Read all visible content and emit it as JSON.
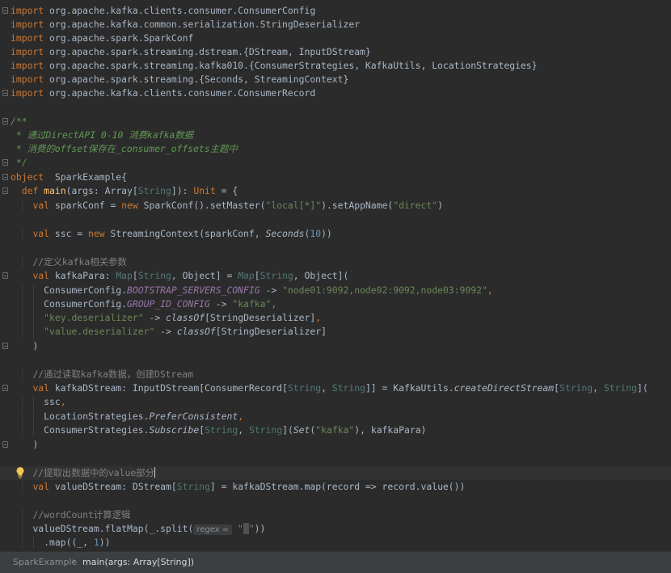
{
  "code": [
    [
      "import",
      " org.apache.kafka.clients.consumer.ConsumerConfig"
    ],
    [
      "import",
      " org.apache.kafka.common.serialization.StringDeserializer"
    ],
    [
      "import",
      " org.apache.spark.SparkConf"
    ],
    [
      "import",
      " org.apache.spark.streaming.dstream.{DStream, InputDStream}"
    ],
    [
      "import",
      " org.apache.spark.streaming.kafka010.{ConsumerStrategies, KafkaUtils, LocationStrategies}"
    ],
    [
      "import",
      " org.apache.spark.streaming.{Seconds, StreamingContext}"
    ],
    [
      "import",
      " org.apache.kafka.clients.consumer.ConsumerRecord"
    ],
    [],
    [
      "/**"
    ],
    [
      " * 通过DirectAPI 0-10 消费kafka数据"
    ],
    [
      " * 消费的offset保存在_consumer_offsets主题中"
    ],
    [
      " */"
    ],
    [
      "object",
      "  SparkExample{"
    ],
    [
      "  ",
      "def",
      " ",
      "main",
      "(args: Array[",
      "String",
      "]): ",
      "Unit",
      " = {"
    ],
    [
      "    ",
      "val",
      " sparkConf = ",
      "new",
      " SparkConf().setMaster(",
      "\"local[*]\"",
      ").setAppName(",
      "\"direct\"",
      ")"
    ],
    [],
    [
      "    ",
      "val",
      " ssc = ",
      "new",
      " StreamingContext(sparkConf, ",
      "Seconds",
      "(",
      "10",
      "))"
    ],
    [],
    [
      "    ",
      "//定义kafka相关参数"
    ],
    [
      "    ",
      "val",
      " kafkaPara: ",
      "Map",
      "[",
      "String",
      ", Object] = ",
      "Map",
      "[",
      "String",
      ", Object]("
    ],
    [
      "      ",
      "ConsumerConfig.",
      "BOOTSTRAP_SERVERS_CONFIG",
      " -> ",
      "\"node01:9092,node02:9092,node03:9092\"",
      ","
    ],
    [
      "      ",
      "ConsumerConfig.",
      "GROUP_ID_CONFIG",
      " -> ",
      "\"kafka\"",
      ","
    ],
    [
      "      ",
      "\"key.deserializer\"",
      " -> ",
      "classOf",
      "[StringDeserializer]",
      ","
    ],
    [
      "      ",
      "\"value.deserializer\"",
      " -> ",
      "classOf",
      "[StringDeserializer]"
    ],
    [
      "    ",
      ")"
    ],
    [],
    [
      "    ",
      "//通过读取kafka数据，创建DStream"
    ],
    [
      "    ",
      "val",
      " kafkaDStream: InputDStream[ConsumerRecord[",
      "String",
      ", ",
      "String",
      "]] = KafkaUtils.",
      "createDirectStream",
      "[",
      "String",
      ", ",
      "String",
      "]("
    ],
    [
      "      ",
      "ssc",
      ","
    ],
    [
      "      ",
      "LocationStrategies.",
      "PreferConsistent",
      ","
    ],
    [
      "      ",
      "ConsumerStrategies.",
      "Subscribe",
      "[",
      "String",
      ", ",
      "String",
      "](",
      "Set",
      "(",
      "\"kafka\"",
      "), kafkaPara)"
    ],
    [
      "    ",
      ")"
    ],
    [],
    [
      "    ",
      "//提取出数据中的value部分"
    ],
    [
      "    ",
      "val",
      " valueDStream: DStream[",
      "String",
      "] = kafkaDStream.map(record => record.value())"
    ],
    [],
    [
      "    ",
      "//wordCount计算逻辑"
    ],
    [
      "    ",
      "valueDStream.flatMap(_.split(",
      "regex =",
      " ",
      "\"",
      " ",
      "\"",
      "))"
    ],
    [
      "      ",
      ".map((_, ",
      "1",
      "))"
    ]
  ],
  "breadcrumb": {
    "object": "SparkExample",
    "separator": "›",
    "method": "main(args: Array[String])"
  },
  "icons": {
    "intention": "lightbulb-icon",
    "fold": "fold-marker-icon"
  },
  "colors": {
    "background": "#2b2b2b",
    "keyword": "#cc7832",
    "string": "#6a8759",
    "comment": "#808080",
    "doc_comment": "#629755",
    "type": "#507874",
    "function": "#ffc66d",
    "constant": "#9876aa",
    "number": "#6897bb"
  }
}
